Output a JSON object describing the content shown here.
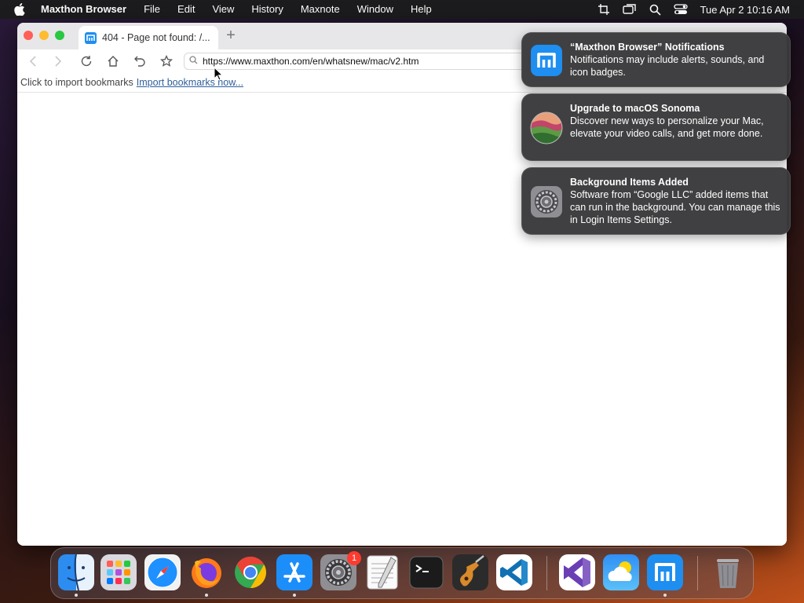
{
  "menubar": {
    "app_name": "Maxthon Browser",
    "items": [
      "File",
      "Edit",
      "View",
      "History",
      "Maxnote",
      "Window",
      "Help"
    ],
    "clock": "Tue Apr 2  10:16 AM"
  },
  "browser": {
    "tab_title": "404 - Page not found: /...",
    "url": "https://www.maxthon.com/en/whatsnew/mac/v2.htm",
    "bookmark_prompt": "Click to import bookmarks",
    "bookmark_link": "Import bookmarks now..."
  },
  "notifications": [
    {
      "title": "“Maxthon Browser” Notifications",
      "body": "Notifications may include alerts, sounds, and icon badges.",
      "icon": "maxthon-icon"
    },
    {
      "title": "Upgrade to macOS Sonoma",
      "body": "Discover new ways to personalize your Mac, elevate your video calls, and get more done.",
      "icon": "macos-sonoma-icon"
    },
    {
      "title": "Background Items Added",
      "body": "Software from “Google LLC” added items that can run in the background. You can manage this in Login Items Settings.",
      "icon": "system-settings-icon"
    }
  ],
  "dock": {
    "settings_badge": "1",
    "apps": [
      "finder",
      "launchpad",
      "safari",
      "firefox",
      "chrome",
      "app-store",
      "system-settings",
      "textedit",
      "terminal",
      "garageband",
      "vscode",
      "visual-studio",
      "weather",
      "maxthon",
      "trash"
    ]
  },
  "colors": {
    "menubar_bg": "#1c1c1e",
    "notification_bg": "#3a3a3c",
    "link": "#2f5f9a",
    "maxthon_blue": "#1e8ef0"
  }
}
